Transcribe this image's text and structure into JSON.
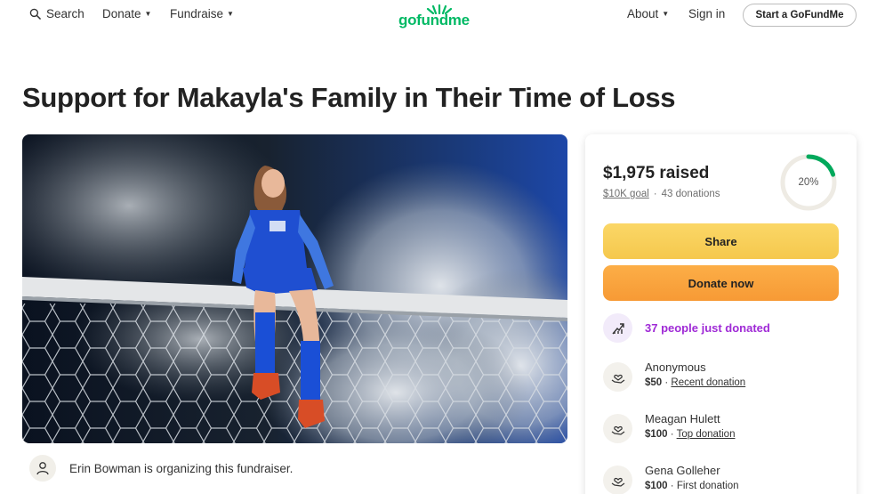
{
  "header": {
    "search_label": "Search",
    "donate_label": "Donate",
    "fundraise_label": "Fundraise",
    "logo_text": "gofundme",
    "about_label": "About",
    "signin_label": "Sign in",
    "start_label": "Start a GoFundMe"
  },
  "campaign": {
    "title": "Support for Makayla's Family in Their Time of Loss",
    "organizer_text": "Erin Bowman is organizing this fundraiser."
  },
  "donation_card": {
    "raised": "$1,975 raised",
    "goal": "$10K goal",
    "donations": "43 donations",
    "progress_percent_label": "20%",
    "progress_fraction": 0.2,
    "share_label": "Share",
    "donate_label": "Donate now",
    "recent_activity": "37 people just donated",
    "donors": [
      {
        "name": "Anonymous",
        "amount": "$50",
        "tag": "Recent donation"
      },
      {
        "name": "Meagan Hulett",
        "amount": "$100",
        "tag": "Top donation"
      },
      {
        "name": "Gena Golleher",
        "amount": "$100",
        "tag": "First donation"
      }
    ]
  },
  "colors": {
    "brand_green": "#00b964",
    "share_yellow": "#f5c84d",
    "donate_orange": "#f79a35",
    "activity_purple": "#9f2ad6"
  },
  "icons": [
    "search-icon",
    "chevron-down-icon",
    "user-icon",
    "trending-up-icon",
    "heart-hand-icon"
  ]
}
